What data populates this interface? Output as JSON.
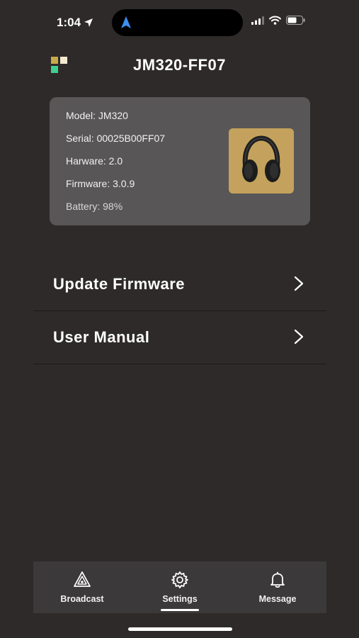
{
  "status_bar": {
    "time": "1:04"
  },
  "header": {
    "title": "JM320-FF07"
  },
  "device_info": {
    "model": "Model: JM320",
    "serial": "Serial: 00025B00FF07",
    "hardware": "Harware: 2.0",
    "firmware": "Firmware: 3.0.9",
    "battery": "Battery: 98%"
  },
  "menu": {
    "items": [
      {
        "label": "Update Firmware"
      },
      {
        "label": "User Manual"
      }
    ]
  },
  "tab_bar": {
    "active": "Settings",
    "tabs": [
      {
        "label": "Broadcast",
        "icon": "broadcast-icon"
      },
      {
        "label": "Settings",
        "icon": "gear-icon"
      },
      {
        "label": "Message",
        "icon": "bell-icon"
      }
    ]
  },
  "colors": {
    "background": "#2d2a29",
    "card": "#585656",
    "product_bg": "#c4a25d",
    "tab_bar": "#3b3939",
    "accent_blue": "#3d8ef0"
  }
}
